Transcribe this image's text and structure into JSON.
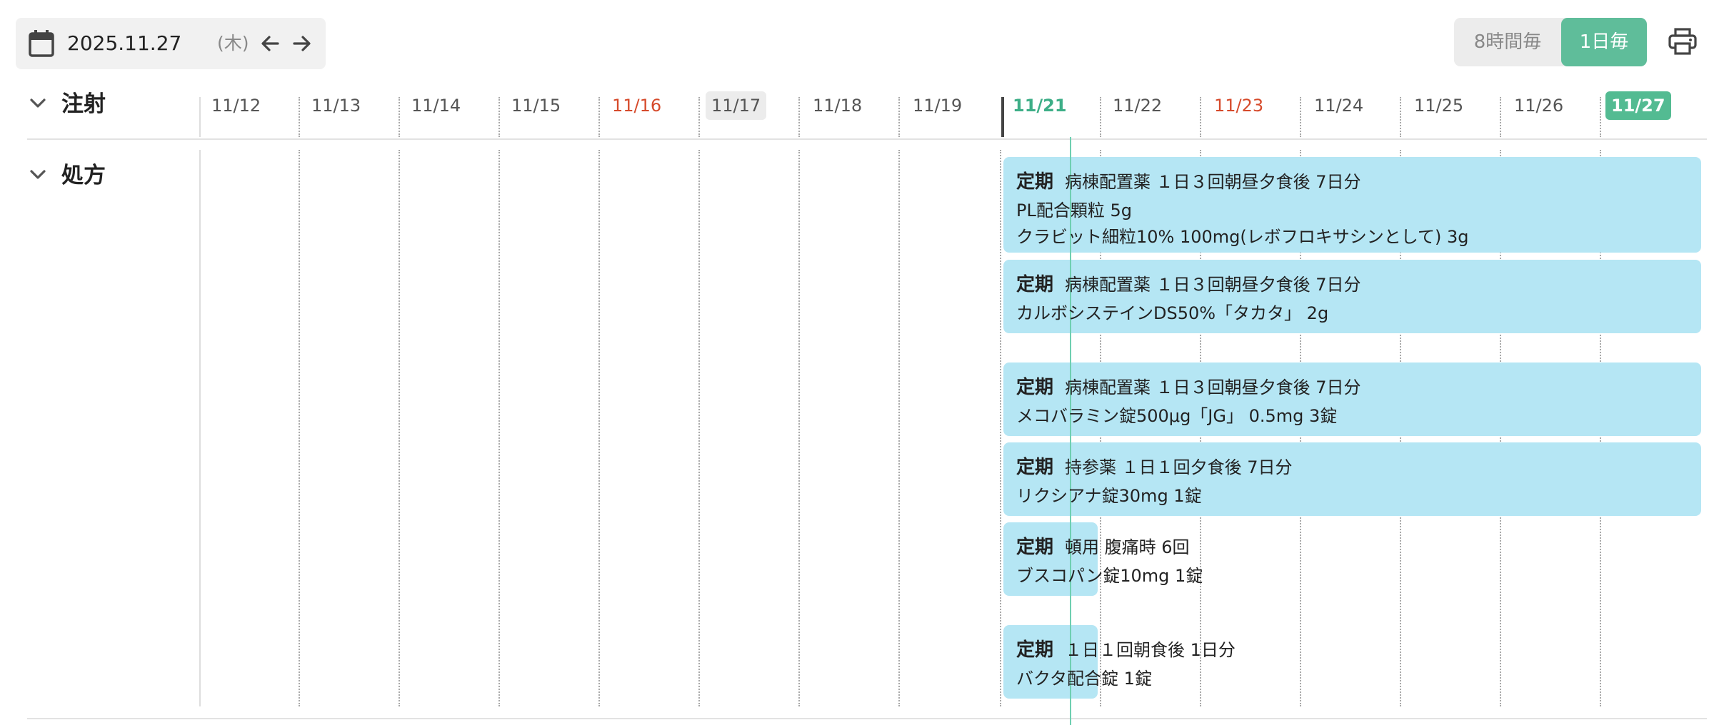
{
  "toolbar": {
    "date": "2025.11.27",
    "weekday": "(木)",
    "modes": [
      {
        "label": "8時間毎",
        "active": false
      },
      {
        "label": "1日毎",
        "active": true
      }
    ],
    "accent_color": "#5fbd9a"
  },
  "timeline": {
    "dates": [
      "11/12",
      "11/13",
      "11/14",
      "11/15",
      "11/16",
      "11/17",
      "11/18",
      "11/19",
      "11/21",
      "11/22",
      "11/23",
      "11/24",
      "11/25",
      "11/26",
      "11/27"
    ],
    "holiday_dates": [
      "11/16",
      "11/23"
    ],
    "highlighted_date": "11/17",
    "today": "11/21",
    "selected_date": "11/27",
    "holiday_color": "#d64a2b",
    "today_color": "#3dae87"
  },
  "sections": {
    "injection": {
      "title": "注射"
    },
    "prescription": {
      "title": "処方"
    }
  },
  "prescriptions": [
    {
      "kind": "定期",
      "instruction": "病棟配置薬 １日３回朝昼夕食後 7日分",
      "drugs": [
        "PL配合顆粒 5g",
        "クラビット細粒10% 100mg(レボフロキサシンとして) 3g"
      ]
    },
    {
      "kind": "定期",
      "instruction": "病棟配置薬 １日３回朝昼夕食後 7日分",
      "drugs": [
        "カルボシステインDS50%「タカタ」 2g"
      ]
    },
    {
      "kind": "定期",
      "instruction": "病棟配置薬 １日３回朝昼夕食後 7日分",
      "drugs": [
        "メコバラミン錠500μg「JG」 0.5mg 3錠"
      ]
    },
    {
      "kind": "定期",
      "instruction": "持参薬 １日１回夕食後 7日分",
      "drugs": [
        "リクシアナ錠30mg 1錠"
      ]
    },
    {
      "kind": "定期",
      "instruction": "頓用 腹痛時 6回",
      "drugs": [
        "ブスコパン錠10mg 1錠"
      ]
    },
    {
      "kind": "定期",
      "instruction": "１日１回朝食後 1日分",
      "drugs": [
        "バクタ配合錠 1錠"
      ]
    }
  ],
  "block_color": "#b5e6f4"
}
